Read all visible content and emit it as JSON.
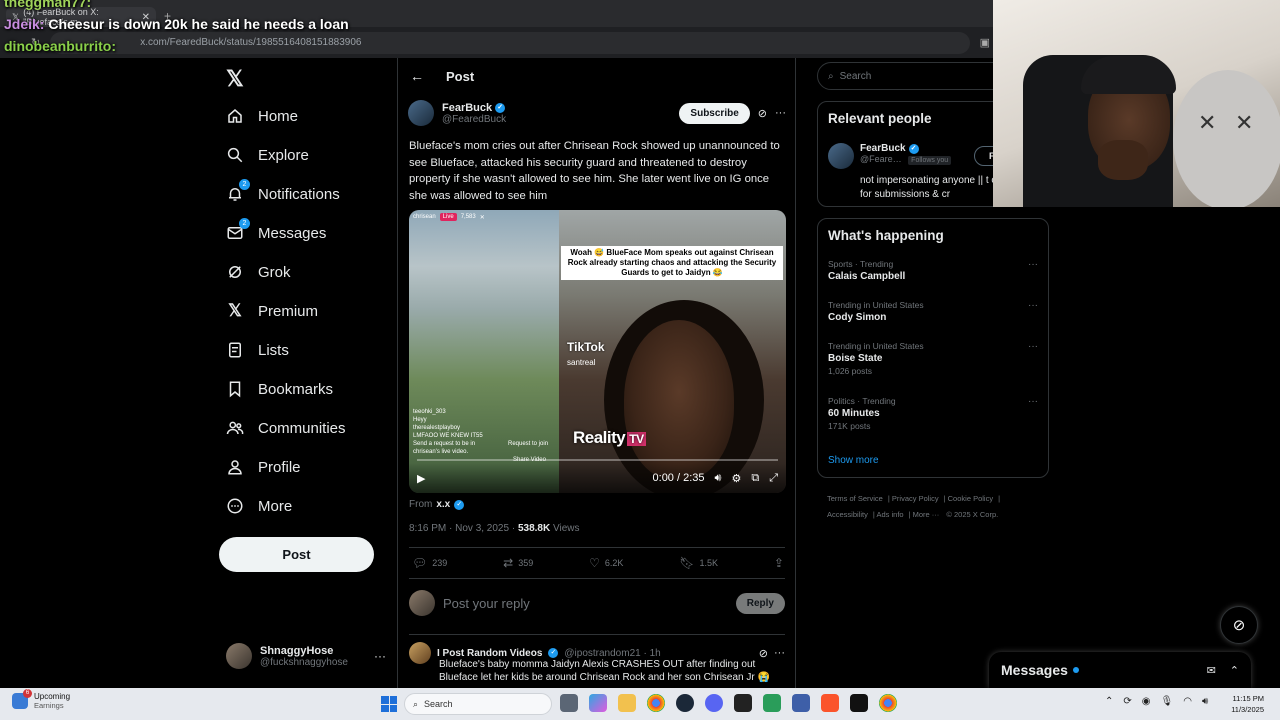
{
  "browser": {
    "tab_title": "(4) FearBuck on X: \"Blueface's m",
    "url": "x.com/FearedBuck/status/1985516408151883906"
  },
  "chat_overlay": [
    {
      "user": "theggman77:",
      "message": ""
    },
    {
      "user": "Jdeik:",
      "message": "Cheesur is down 20k he said he needs a loan"
    },
    {
      "user": "dinobeanburrito:",
      "message": ""
    }
  ],
  "leftnav": {
    "items": [
      {
        "label": "Home",
        "icon": "home-icon"
      },
      {
        "label": "Explore",
        "icon": "search-icon"
      },
      {
        "label": "Notifications",
        "icon": "bell-icon",
        "badge": "2"
      },
      {
        "label": "Messages",
        "icon": "mail-icon",
        "badge": "2"
      },
      {
        "label": "Grok",
        "icon": "grok-icon"
      },
      {
        "label": "Premium",
        "icon": "x-logo-icon"
      },
      {
        "label": "Lists",
        "icon": "list-icon"
      },
      {
        "label": "Bookmarks",
        "icon": "bookmark-icon"
      },
      {
        "label": "Communities",
        "icon": "people-icon"
      },
      {
        "label": "Profile",
        "icon": "person-icon"
      },
      {
        "label": "More",
        "icon": "more-circle-icon"
      }
    ],
    "post_button": "Post",
    "account": {
      "name": "ShnaggyHose",
      "handle": "@fuckshnaggyhose"
    }
  },
  "main": {
    "header": "Post",
    "author": {
      "name": "FearBuck",
      "handle": "@FearedBuck",
      "subscribe": "Subscribe"
    },
    "text": "Blueface's mom cries out after Chrisean Rock showed up unannounced to see Blueface, attacked his security guard and threatened to destroy property if she wasn't allowed to see him. She later went live on IG once she was allowed to see him",
    "video": {
      "caption": "Woah 😅 BlueFace Mom speaks out against Chrisean Rock already starting chaos and attacking the Security Guards to get to Jaidyn 😂",
      "live_user": "chrisean",
      "live_label": "Live",
      "viewers": "7,583",
      "tiktok": "TikTok",
      "tiktok_user": "santreal",
      "reality": "Reality",
      "reality_tv": "TV",
      "comments": [
        "teeohki_303",
        "Heyy",
        "therealestplayboy",
        "LMFAOO WE KNEW IT55",
        "Send a request to be in",
        "chrisean's live video.",
        "Request to join",
        "Share Video"
      ],
      "time": "0:00 / 2:35",
      "progress": 0.0
    },
    "from_label": "From",
    "from_user": "x.x",
    "timestamp": "8:16 PM · Nov 3, 2025 ·",
    "views": "538.8K",
    "views_label": "Views",
    "actions": {
      "replies": "239",
      "reposts": "359",
      "likes": "6.2K",
      "bookmarks": "1.5K"
    },
    "reply_placeholder": "Post your reply",
    "reply_button": "Reply",
    "reply_post": {
      "name": "I Post Random Videos",
      "handle": "@ipostrandom21 · 1h",
      "text": "Blueface's baby momma Jaidyn Alexis CRASHES OUT after finding out Blueface let her kids be around Chrisean Rock and her son Chrisean Jr 😭"
    }
  },
  "right": {
    "search_placeholder": "Search",
    "relevant": {
      "title": "Relevant people",
      "name": "FearBuck",
      "handle": "@Feare…",
      "follows_you": "Follows you",
      "follow": "Follow",
      "bio": "not impersonating anyone || t on || DM for submissions & cr"
    },
    "happening": {
      "title": "What's happening",
      "trends": [
        {
          "category": "Sports · Trending",
          "title": "Calais Campbell",
          "count": ""
        },
        {
          "category": "Trending in United States",
          "title": "Cody Simon",
          "count": ""
        },
        {
          "category": "Trending in United States",
          "title": "Boise State",
          "count": "1,026 posts"
        },
        {
          "category": "Politics · Trending",
          "title": "60 Minutes",
          "count": "171K posts"
        }
      ],
      "show_more": "Show more"
    },
    "footer": [
      "Terms of Service",
      "Privacy Policy",
      "Cookie Policy",
      "Accessibility",
      "Ads info",
      "More ···",
      "© 2025 X Corp."
    ]
  },
  "messages_drawer": {
    "title": "Messages"
  },
  "taskbar": {
    "weather_title": "Upcoming",
    "weather_sub": "Earnings",
    "weather_badge": "6",
    "search": "Search",
    "time": "11:15 PM",
    "date": "11/3/2025"
  },
  "colors": {
    "accent": "#1d9bf0",
    "background": "#000000",
    "text": "#e7e9ea",
    "muted": "#71767b",
    "border": "#2f3336"
  }
}
